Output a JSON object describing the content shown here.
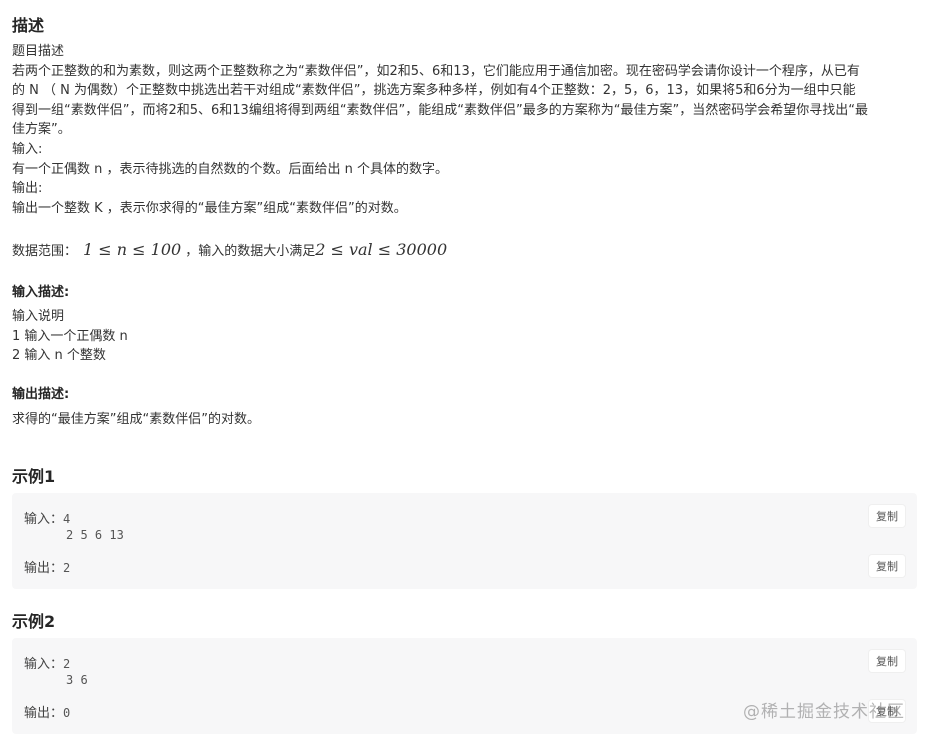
{
  "header": {
    "title": "描述"
  },
  "description": {
    "lines": [
      "题目描述",
      "若两个正整数的和为素数，则这两个正整数称之为“素数伴侣”，如2和5、6和13，它们能应用于通信加密。现在密码学会请你设计一个程序，从已有",
      "的 N （ N 为偶数）个正整数中挑选出若干对组成“素数伴侣”，挑选方案多种多样，例如有4个正整数：2，5，6，13，如果将5和6分为一组中只能",
      "得到一组“素数伴侣”，而将2和5、6和13编组将得到两组“素数伴侣”，能组成“素数伴侣”最多的方案称为“最佳方案”，当然密码学会希望你寻找出“最",
      "佳方案”。",
      "输入:",
      "有一个正偶数 n ，表示待挑选的自然数的个数。后面给出 n 个具体的数字。",
      "输出:",
      "输出一个整数 K ，表示你求得的“最佳方案”组成“素数伴侣”的对数。"
    ],
    "range_label": "数据范围：",
    "range_math_1": "1 ≤ n ≤ 100",
    "range_mid": " ，输入的数据大小满足 ",
    "range_math_2": "2 ≤ val ≤ 30000"
  },
  "input_desc": {
    "title": "输入描述:",
    "lines": [
      "输入说明",
      "1 输入一个正偶数 n",
      "2 输入 n 个整数"
    ]
  },
  "output_desc": {
    "title": "输出描述:",
    "text": "求得的“最佳方案”组成“素数伴侣”的对数。"
  },
  "examples": [
    {
      "title": "示例1",
      "input_label": "输入：",
      "input_lines": [
        "4",
        "2 5 6 13"
      ],
      "output_label": "输出：",
      "output": "2",
      "copy_label": "复制"
    },
    {
      "title": "示例2",
      "input_label": "输入：",
      "input_lines": [
        "2",
        "3 6"
      ],
      "output_label": "输出：",
      "output": "0",
      "copy_label": "复制"
    }
  ],
  "watermark": "@稀土掘金技术社区"
}
